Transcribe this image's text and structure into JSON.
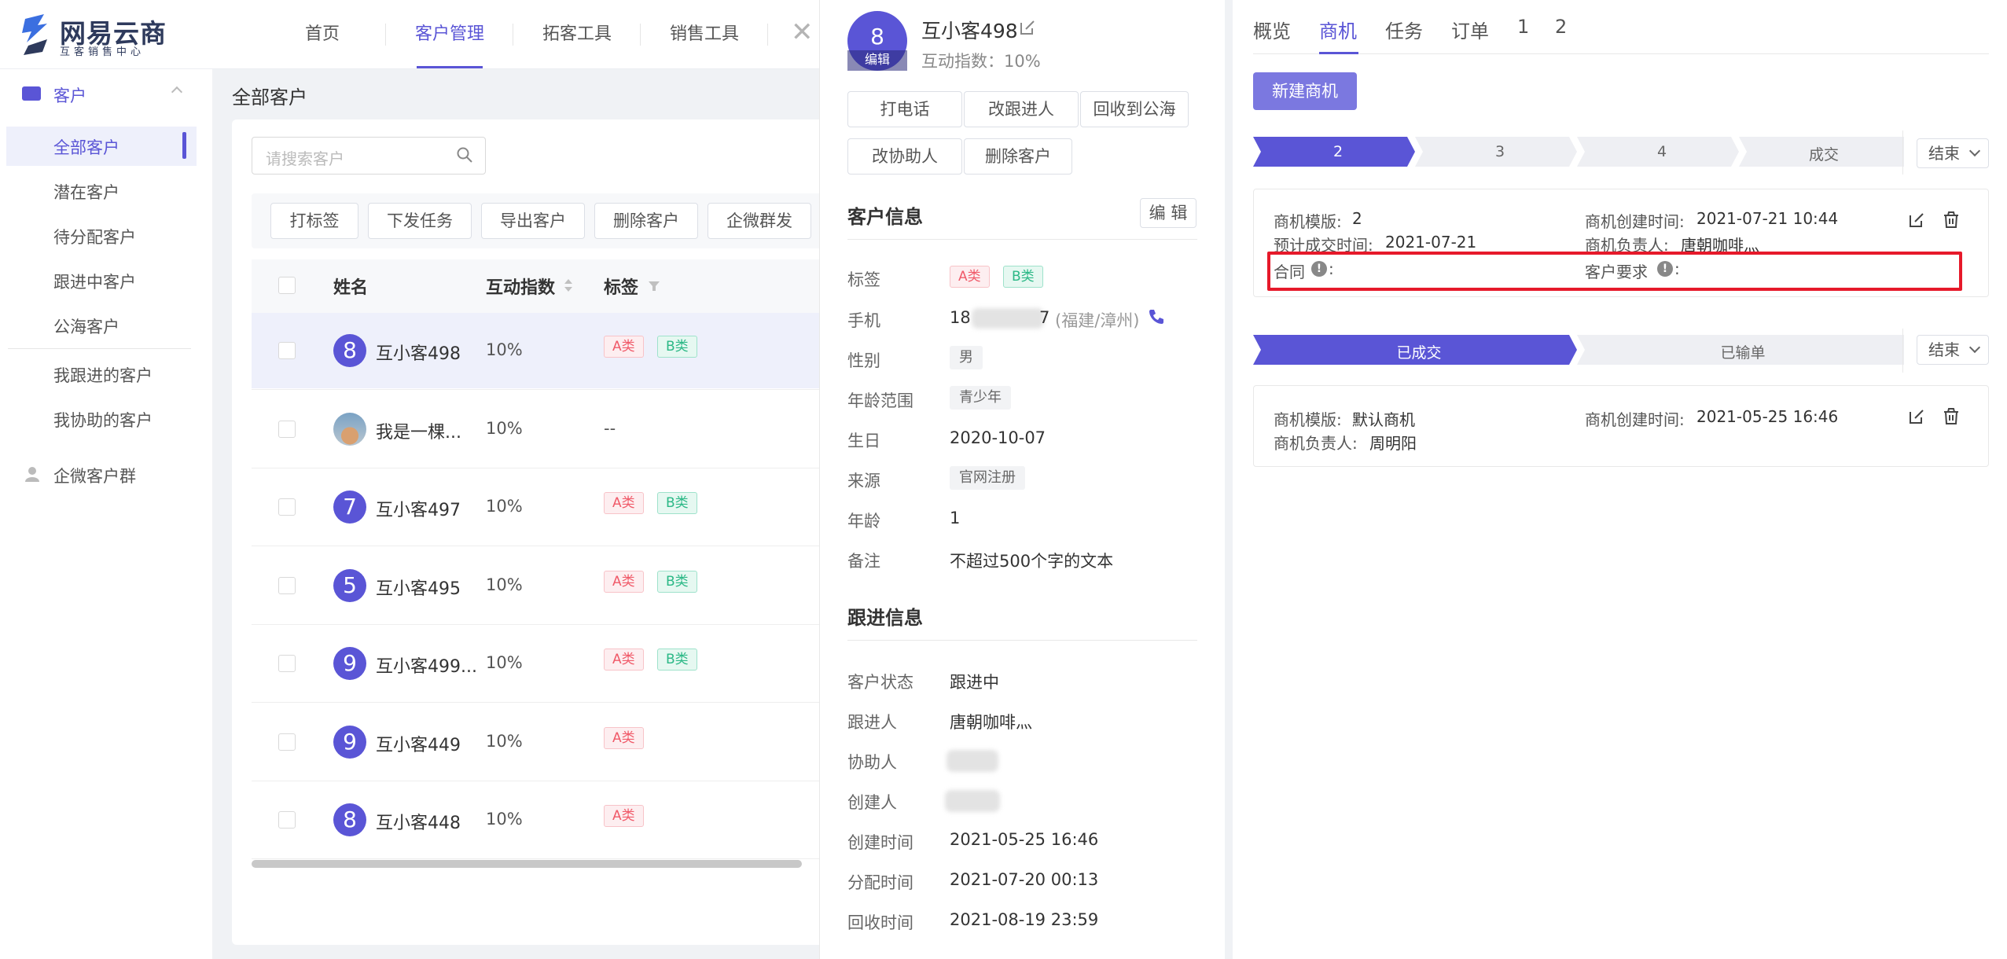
{
  "brand": {
    "title": "网易云商",
    "subtitle": "互客销售中心"
  },
  "nav": {
    "items": [
      "首页",
      "客户管理",
      "拓客工具",
      "销售工具"
    ],
    "active": "客户管理"
  },
  "sidebar": {
    "group": "客户",
    "items": [
      "全部客户",
      "潜在客户",
      "待分配客户",
      "跟进中客户",
      "公海客户"
    ],
    "items2": [
      "我跟进的客户",
      "我协助的客户"
    ],
    "group2": "企微客户群",
    "active": "全部客户"
  },
  "main": {
    "title": "全部客户",
    "search_placeholder": "请搜索客户",
    "toolbar": [
      "打标签",
      "下发任务",
      "导出客户",
      "删除客户",
      "企微群发"
    ],
    "columns": {
      "name": "姓名",
      "index": "互动指数",
      "tags": "标签"
    },
    "rows": [
      {
        "avatar": "8",
        "name": "互小客498",
        "index": "10%",
        "tags": [
          "A类",
          "B类"
        ]
      },
      {
        "avatar": "",
        "name": "我是一棵...",
        "index": "10%",
        "tags": [],
        "empty": "--"
      },
      {
        "avatar": "7",
        "name": "互小客497",
        "index": "10%",
        "tags": [
          "A类",
          "B类"
        ]
      },
      {
        "avatar": "5",
        "name": "互小客495",
        "index": "10%",
        "tags": [
          "A类",
          "B类"
        ]
      },
      {
        "avatar": "9",
        "name": "互小客499...",
        "index": "10%",
        "tags": [
          "A类",
          "B类"
        ]
      },
      {
        "avatar": "9",
        "name": "互小客449",
        "index": "10%",
        "tags": [
          "A类"
        ]
      },
      {
        "avatar": "8",
        "name": "互小客448",
        "index": "10%",
        "tags": [
          "A类"
        ]
      }
    ]
  },
  "drawer": {
    "avatar_num": "8",
    "avatar_edit": "编辑",
    "name": "互小客498",
    "index_line": "互动指数：10%",
    "actions": [
      "打电话",
      "改跟进人",
      "回收到公海",
      "改协助人",
      "删除客户"
    ],
    "section_customer": "客户信息",
    "edit_label": "编 辑",
    "fields": {
      "tag_label": "标签",
      "tags": [
        "A类",
        "B类"
      ],
      "phone_label": "手机",
      "phone_prefix": "18",
      "phone_suffix": "7",
      "phone_region": "(福建/漳州)",
      "gender_label": "性别",
      "gender": "男",
      "age_range_label": "年龄范围",
      "age_range": "青少年",
      "birthday_label": "生日",
      "birthday": "2020-10-07",
      "source_label": "来源",
      "source": "官网注册",
      "age_label": "年龄",
      "age": "1",
      "note_label": "备注",
      "note": "不超过500个字的文本"
    },
    "section_follow": "跟进信息",
    "follow": {
      "status_label": "客户状态",
      "status": "跟进中",
      "owner_label": "跟进人",
      "owner": "唐朝咖啡灬",
      "helper_label": "协助人",
      "creator_label": "创建人",
      "created_label": "创建时间",
      "created": "2021-05-25 16:46",
      "assigned_label": "分配时间",
      "assigned": "2021-07-20 00:13",
      "recycled_label": "回收时间",
      "recycled": "2021-08-19 23:59"
    }
  },
  "right": {
    "tabs": [
      "概览",
      "商机",
      "任务",
      "订单",
      "1",
      "2"
    ],
    "active_tab": "商机",
    "new_button": "新建商机",
    "end_label": "结束",
    "pipeline1": {
      "stages": [
        "2",
        "3",
        "4",
        "成交"
      ],
      "active_index": 0
    },
    "opp1": {
      "template_label": "商机模版:",
      "template": "2",
      "created_label": "商机创建时间:",
      "created": "2021-07-21 10:44",
      "expected_label": "预计成交时间:",
      "expected": "2021-07-21",
      "owner_label": "商机负责人:",
      "owner": "唐朝咖啡灬",
      "contract_label": "合同",
      "requirement_label": "客户要求"
    },
    "pipeline2": {
      "stages": [
        "已成交",
        "已输单"
      ],
      "active_index": 0
    },
    "opp2": {
      "template_label": "商机模版:",
      "template": "默认商机",
      "created_label": "商机创建时间:",
      "created": "2021-05-25 16:46",
      "owner_label": "商机负责人:",
      "owner": "周明阳"
    }
  },
  "colors": {
    "accent": "#5a55d6",
    "highlight": "#e6192a"
  }
}
